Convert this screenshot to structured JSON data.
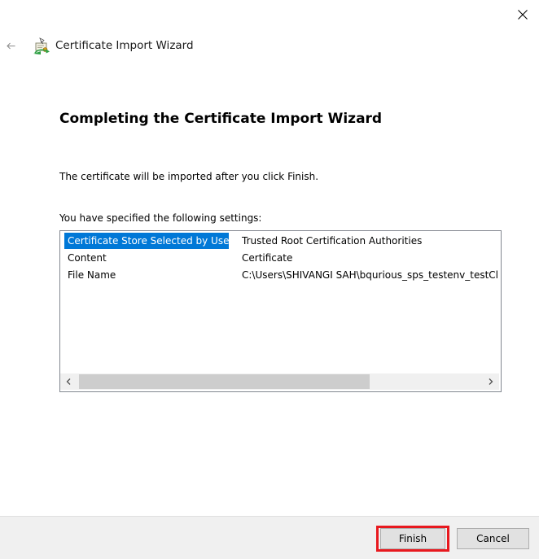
{
  "window": {
    "title": "Certificate Import Wizard",
    "icons": {
      "close": "close-icon",
      "back": "back-arrow-icon",
      "title": "certificate-wizard-icon"
    }
  },
  "page": {
    "heading": "Completing the Certificate Import Wizard",
    "info": "The certificate will be imported after you click Finish.",
    "settings_label": "You have specified the following settings:"
  },
  "settings": {
    "rows": [
      {
        "key": "Certificate Store Selected by User",
        "value": "Trusted Root Certification Authorities",
        "selected": true
      },
      {
        "key": "Content",
        "value": "Certificate",
        "selected": false
      },
      {
        "key": "File Name",
        "value": "C:\\Users\\SHIVANGI SAH\\bqurious_sps_testenv_testCl",
        "selected": false
      }
    ],
    "scrollbar": {
      "left_arrow": "chevron-left-icon",
      "right_arrow": "chevron-right-icon"
    }
  },
  "buttons": {
    "finish": "Finish",
    "cancel": "Cancel"
  },
  "colors": {
    "selection": "#0078d7",
    "highlight_border": "#e8191f",
    "footer_bg": "#f0f0f0"
  }
}
